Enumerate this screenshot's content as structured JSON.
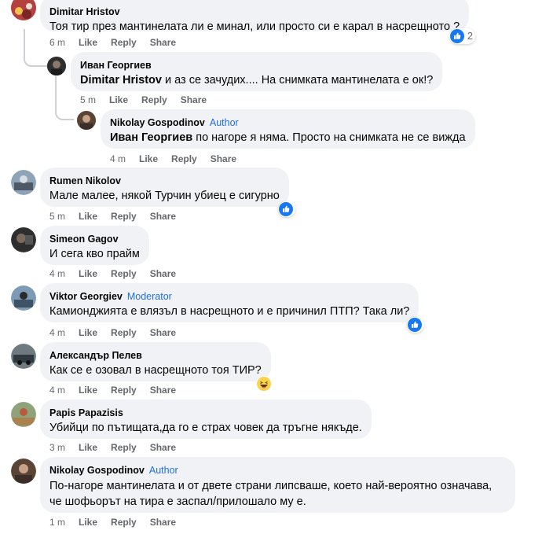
{
  "actions": {
    "like": "Like",
    "reply": "Reply",
    "share": "Share"
  },
  "colors": {
    "bubble": "#f0f2f5",
    "badge": "#216fdb",
    "meta": "#65676b",
    "like_blue": "#1877f2"
  },
  "comments": [
    {
      "name": "Dimitar Hristov",
      "badge": "",
      "text": "Тоя тир през мантинелата ли е минал, или просто си е карал в насрещното ?",
      "time": "6 m",
      "reaction_icon": "like-icon",
      "reaction_count": "2"
    },
    {
      "name": "Иван Георгиев",
      "badge": "",
      "mention": "Dimitar Hristov",
      "text": " и аз се зачудих.... На снимката мантинелата е ок!?",
      "time": "5 m"
    },
    {
      "name": "Nikolay Gospodinov",
      "badge": "Author",
      "mention": "Иван Георгиев",
      "text": " по нагоре я няма. Просто на снимката не се вижда",
      "time": "4 m"
    },
    {
      "name": "Rumen Nikolov",
      "badge": "",
      "text": "Мале малее, някой Турчин убиец е сигурно",
      "time": "5 m",
      "reaction_icon": "like-icon"
    },
    {
      "name": "Simeon Gagov",
      "badge": "",
      "text": "И сега кво прайм",
      "time": "4 m"
    },
    {
      "name": "Viktor Georgiev",
      "badge": "Moderator",
      "text": "Камионджията е влязъл в насрещното и е причинил ПТП? Така ли?",
      "time": "4 m",
      "reaction_icon": "like-icon"
    },
    {
      "name": "Александър Пелев",
      "badge": "",
      "text": "Как се е озовал в насрещното тоя ТИР?",
      "time": "4 m",
      "reaction_icon": "haha-icon"
    },
    {
      "name": "Papis Papazisis",
      "badge": "",
      "text": "Убийци по пътищата,да го е страх човек да тръгне някъде.",
      "time": "3 m"
    },
    {
      "name": "Nikolay Gospodinov",
      "badge": "Author",
      "text": "По-нагоре мантинелата и от двете страни липсваше, което най-вероятно означава, че шофьорът на тира е заспал/прилошало му е.",
      "time": "1 m"
    }
  ]
}
